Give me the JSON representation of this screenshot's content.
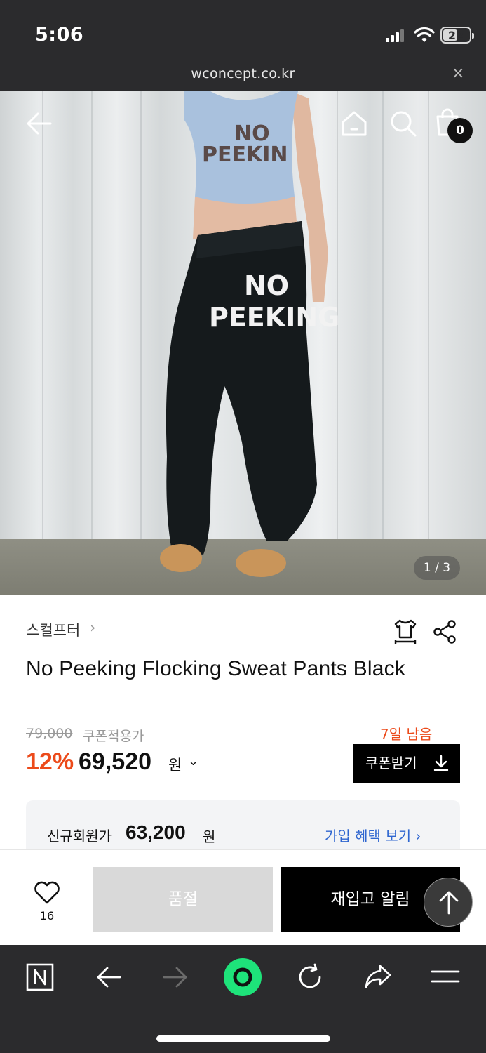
{
  "status_bar": {
    "time": "5:06",
    "battery": "22"
  },
  "browser": {
    "url": "wconcept.co.kr",
    "close_glyph": "×"
  },
  "hero": {
    "image_counter": "1 / 3",
    "cart_count": "0",
    "icons": [
      "back-arrow-icon",
      "home-icon",
      "search-icon",
      "shopping-bag-icon"
    ],
    "top_print": [
      "NO",
      "PEEKIN"
    ],
    "pants_print": [
      "NO",
      "PEEKING"
    ]
  },
  "product": {
    "brand": "스컬프터",
    "brand_chevron": "›",
    "title": "No Peeking Flocking Sweat Pants Black",
    "original_price": "79,000",
    "coupon_price_label": "쿠폰적용가",
    "discount": "12%",
    "price": "69,520",
    "currency": "원",
    "price_chevron": "⌄",
    "days_left": "7일 남음",
    "coupon_button": "쿠폰받기",
    "member": {
      "label": "신규회원가",
      "price": "63,200",
      "currency": "원",
      "link": "가입 혜택 보기 ›"
    }
  },
  "actions": {
    "wishlist_count": "16",
    "sold_out": "품절",
    "restock_alert": "재입고 알림"
  },
  "colors": {
    "accent": "#ec4a1a",
    "link": "#2f66d0",
    "dark": "#2b2b2d",
    "naver_green": "#1ee37a"
  }
}
